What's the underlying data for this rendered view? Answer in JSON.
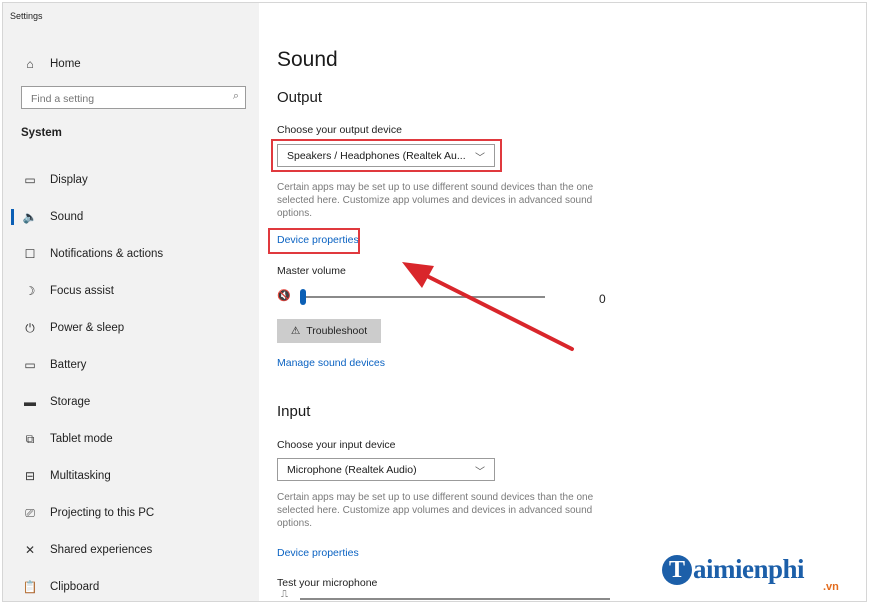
{
  "window": {
    "title": "Settings"
  },
  "sidebar": {
    "home": {
      "icon": "home-icon",
      "label": "Home"
    },
    "search": {
      "placeholder": "Find a setting",
      "icon": "search-icon"
    },
    "section": "System",
    "items": [
      {
        "icon": "display-icon",
        "label": "Display"
      },
      {
        "icon": "sound-icon",
        "label": "Sound",
        "active": true
      },
      {
        "icon": "notifications-icon",
        "label": "Notifications & actions"
      },
      {
        "icon": "focus-assist-icon",
        "label": "Focus assist"
      },
      {
        "icon": "power-icon",
        "label": "Power & sleep"
      },
      {
        "icon": "battery-icon",
        "label": "Battery"
      },
      {
        "icon": "storage-icon",
        "label": "Storage"
      },
      {
        "icon": "tablet-mode-icon",
        "label": "Tablet mode"
      },
      {
        "icon": "multitasking-icon",
        "label": "Multitasking"
      },
      {
        "icon": "projecting-icon",
        "label": "Projecting to this PC"
      },
      {
        "icon": "shared-experiences-icon",
        "label": "Shared experiences"
      },
      {
        "icon": "clipboard-icon",
        "label": "Clipboard"
      }
    ]
  },
  "main": {
    "title": "Sound",
    "output": {
      "heading": "Output",
      "device_label": "Choose your output device",
      "device_value": "Speakers / Headphones (Realtek Au...",
      "help": "Certain apps may be set up to use different sound devices than the one selected here. Customize app volumes and devices in advanced sound options.",
      "device_properties": "Device properties",
      "master_volume_label": "Master volume",
      "master_volume_value": "0",
      "master_volume_level": 0,
      "troubleshoot": "Troubleshoot",
      "manage_devices": "Manage sound devices"
    },
    "input": {
      "heading": "Input",
      "device_label": "Choose your input device",
      "device_value": "Microphone (Realtek Audio)",
      "help": "Certain apps may be set up to use different sound devices than the one selected here. Customize app volumes and devices in advanced sound options.",
      "device_properties": "Device properties",
      "test_label": "Test your microphone"
    }
  },
  "annotations": {
    "highlight_color": "#e0393e",
    "arrow_color": "#d9262b"
  },
  "watermark": {
    "brand": "aimienphi",
    "initial": "T",
    "suffix": ".vn",
    "color": "#1c5fa9"
  }
}
